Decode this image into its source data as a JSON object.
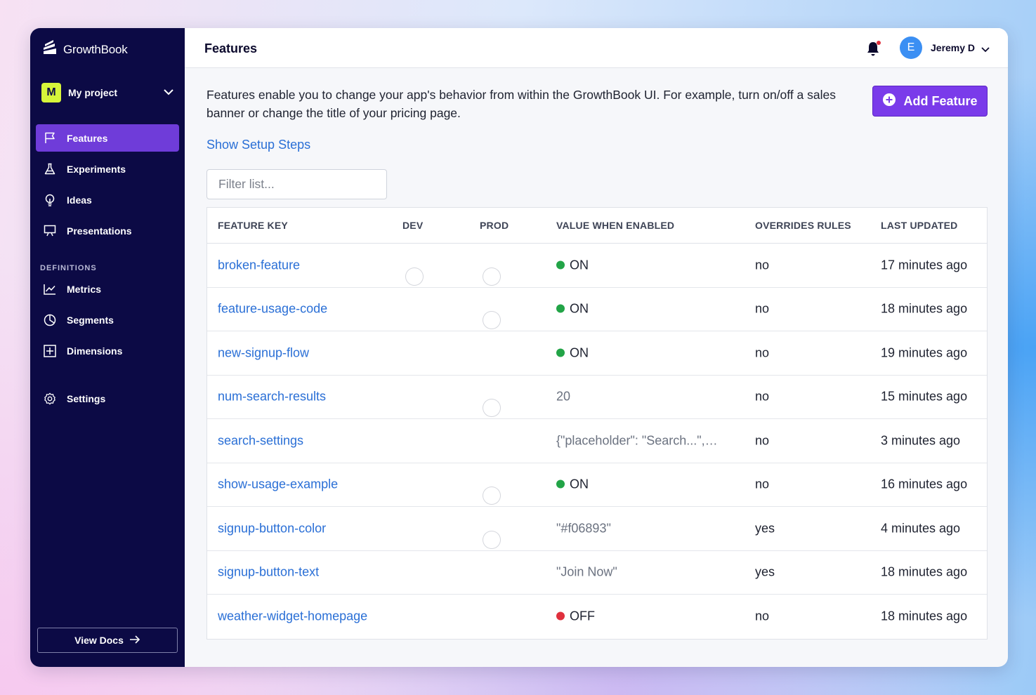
{
  "app": {
    "name": "GrowthBook"
  },
  "project": {
    "badge": "M",
    "name": "My project"
  },
  "nav": {
    "items": [
      {
        "label": "Features",
        "icon": "flag-icon"
      },
      {
        "label": "Experiments",
        "icon": "flask-icon"
      },
      {
        "label": "Ideas",
        "icon": "lightbulb-icon"
      },
      {
        "label": "Presentations",
        "icon": "presentation-icon"
      }
    ],
    "section_label": "DEFINITIONS",
    "definitions": [
      {
        "label": "Metrics",
        "icon": "chart-line-icon"
      },
      {
        "label": "Segments",
        "icon": "pie-chart-icon"
      },
      {
        "label": "Dimensions",
        "icon": "grid-icon"
      }
    ],
    "settings": {
      "label": "Settings",
      "icon": "gear-icon"
    },
    "view_docs": "View Docs"
  },
  "header": {
    "title": "Features",
    "user_initial": "E",
    "user_name": "Jeremy D"
  },
  "main": {
    "intro": "Features enable you to change your app's behavior from within the GrowthBook UI. For example, turn on/off a sales banner or change the title of your pricing page.",
    "add_button": "Add Feature",
    "setup_link": "Show Setup Steps",
    "filter_placeholder": "Filter list..."
  },
  "table": {
    "headers": [
      "FEATURE KEY",
      "DEV",
      "PROD",
      "VALUE WHEN ENABLED",
      "OVERRIDES RULES",
      "LAST UPDATED"
    ],
    "rows": [
      {
        "key": "broken-feature",
        "dev": false,
        "prod": false,
        "value": "ON",
        "value_kind": "on",
        "overrides": "no",
        "updated": "17 minutes ago"
      },
      {
        "key": "feature-usage-code",
        "dev": true,
        "prod": false,
        "value": "ON",
        "value_kind": "on",
        "overrides": "no",
        "updated": "18 minutes ago"
      },
      {
        "key": "new-signup-flow",
        "dev": true,
        "prod": true,
        "value": "ON",
        "value_kind": "on",
        "overrides": "no",
        "updated": "19 minutes ago"
      },
      {
        "key": "num-search-results",
        "dev": true,
        "prod": false,
        "value": "20",
        "value_kind": "raw",
        "overrides": "no",
        "updated": "15 minutes ago"
      },
      {
        "key": "search-settings",
        "dev": true,
        "prod": true,
        "value": "{\"placeholder\": \"Search...\",…",
        "value_kind": "raw",
        "overrides": "no",
        "updated": "3 minutes ago"
      },
      {
        "key": "show-usage-example",
        "dev": true,
        "prod": false,
        "value": "ON",
        "value_kind": "on",
        "overrides": "no",
        "updated": "16 minutes ago"
      },
      {
        "key": "signup-button-color",
        "dev": true,
        "prod": false,
        "value": "\"#f06893\"",
        "value_kind": "raw",
        "overrides": "yes",
        "updated": "4 minutes ago"
      },
      {
        "key": "signup-button-text",
        "dev": true,
        "prod": true,
        "value": "\"Join Now\"",
        "value_kind": "raw",
        "overrides": "yes",
        "updated": "18 minutes ago"
      },
      {
        "key": "weather-widget-homepage",
        "dev": true,
        "prod": true,
        "value": "OFF",
        "value_kind": "off",
        "overrides": "no",
        "updated": "18 minutes ago"
      }
    ]
  },
  "colors": {
    "accent": "#6f3cd9",
    "sidebar": "#0c0a45",
    "toggle_on": "#4a1aa8",
    "on_dot": "#22a447",
    "off_dot": "#e0303d",
    "link": "#2a6fd6"
  }
}
